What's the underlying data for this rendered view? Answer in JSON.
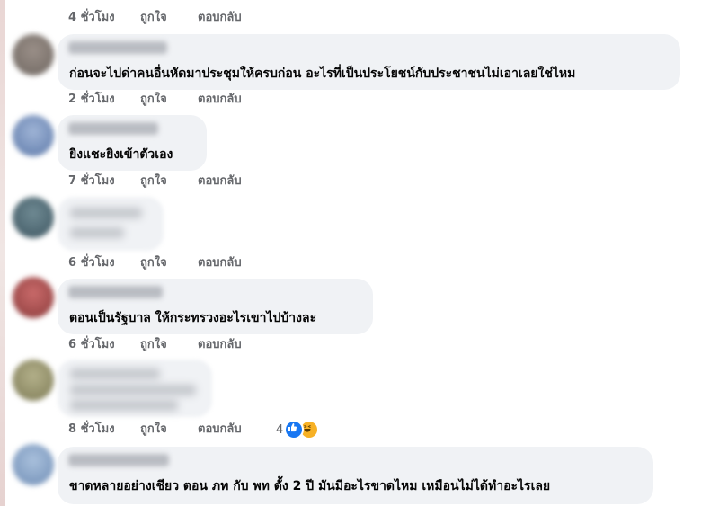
{
  "actions": {
    "like": "ถูกใจ",
    "reply": "ตอบกลับ"
  },
  "comments": [
    {
      "time": "4 ชั่วโมง"
    },
    {
      "text": "ก่อนจะไปด่าคนอื่นหัดมาประชุมให้ครบก่อน อะไรที่เป็นประโยชน์กับประชาชนไม่เอาเลยใช่ไหม",
      "time": "2 ชั่วโมง"
    },
    {
      "text": "ยิงแชะยิงเข้าตัวเอง",
      "time": "7 ชั่วโมง"
    },
    {
      "text": "",
      "time": "6 ชั่วโมง"
    },
    {
      "text": "ตอนเป็นรัฐบาล ให้กระทรวงอะไรเขาไปบ้างละ",
      "time": "6 ชั่วโมง"
    },
    {
      "text": "",
      "time": "8 ชั่วโมง",
      "reactions": {
        "count": "4",
        "icons": [
          "like-icon",
          "haha-icon"
        ]
      }
    },
    {
      "text": "ขาดหลายอย่างเชียว ตอน ภท กับ พท ตั้ง 2 ปี มันมีอะไรขาดไหม เหมือนไม่ได้ทำอะไรเลย"
    }
  ],
  "colors": {
    "bubble": "#f0f2f5",
    "meta": "#65676b",
    "like_blue": "#1877f2",
    "haha_yellow": "#f7b125"
  }
}
